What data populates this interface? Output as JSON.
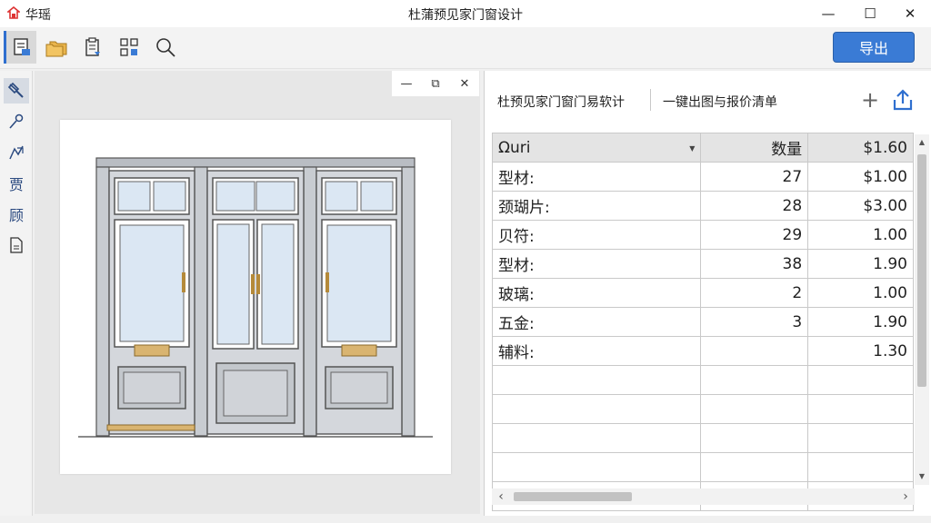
{
  "window": {
    "app_name": "华瑶",
    "title": "杜蒲预见家门窗设计",
    "controls": {
      "minimize": "—",
      "maximize": "☐",
      "close": "✕"
    }
  },
  "toolbar": {
    "items": [
      "layout-icon",
      "folders-icon",
      "clipboard-icon",
      "components-icon",
      "search-icon"
    ],
    "export_label": "导出"
  },
  "sidebar": {
    "tools": [
      "move-icon",
      "pen-icon",
      "draw-icon",
      "material-icon",
      "frame-icon",
      "document-icon"
    ],
    "labels": {
      "material": "贾",
      "frame": "顾"
    }
  },
  "canvas_panel": {
    "controls": {
      "minimize": "—",
      "restore": "⧉",
      "close": "✕"
    }
  },
  "right_panel": {
    "tab1": "杜预见家门窗门易软计",
    "tab2": "一键出图与报价清单",
    "plus": "+"
  },
  "table": {
    "header": [
      "Ωuri",
      "数量",
      "$1.60"
    ],
    "rows": [
      [
        "型材:",
        "27",
        "$1.00"
      ],
      [
        "颈瑚片:",
        "28",
        "$3.00"
      ],
      [
        "贝符:",
        "29",
        "1.00"
      ],
      [
        "型材:",
        "38",
        "1.90"
      ],
      [
        "玻璃:",
        "2",
        "1.00"
      ],
      [
        "五金:",
        "3",
        "1.90"
      ],
      [
        "辅料:",
        "",
        "1.30"
      ],
      [
        "",
        "",
        ""
      ],
      [
        "",
        "",
        ""
      ],
      [
        "",
        "",
        ""
      ],
      [
        "",
        "",
        ""
      ],
      [
        "",
        "",
        ""
      ]
    ]
  },
  "colors": {
    "accent": "#3a7bd5",
    "frame": "#5a5f66",
    "glass": "#dbe7f3",
    "brass": "#b58a3a"
  }
}
